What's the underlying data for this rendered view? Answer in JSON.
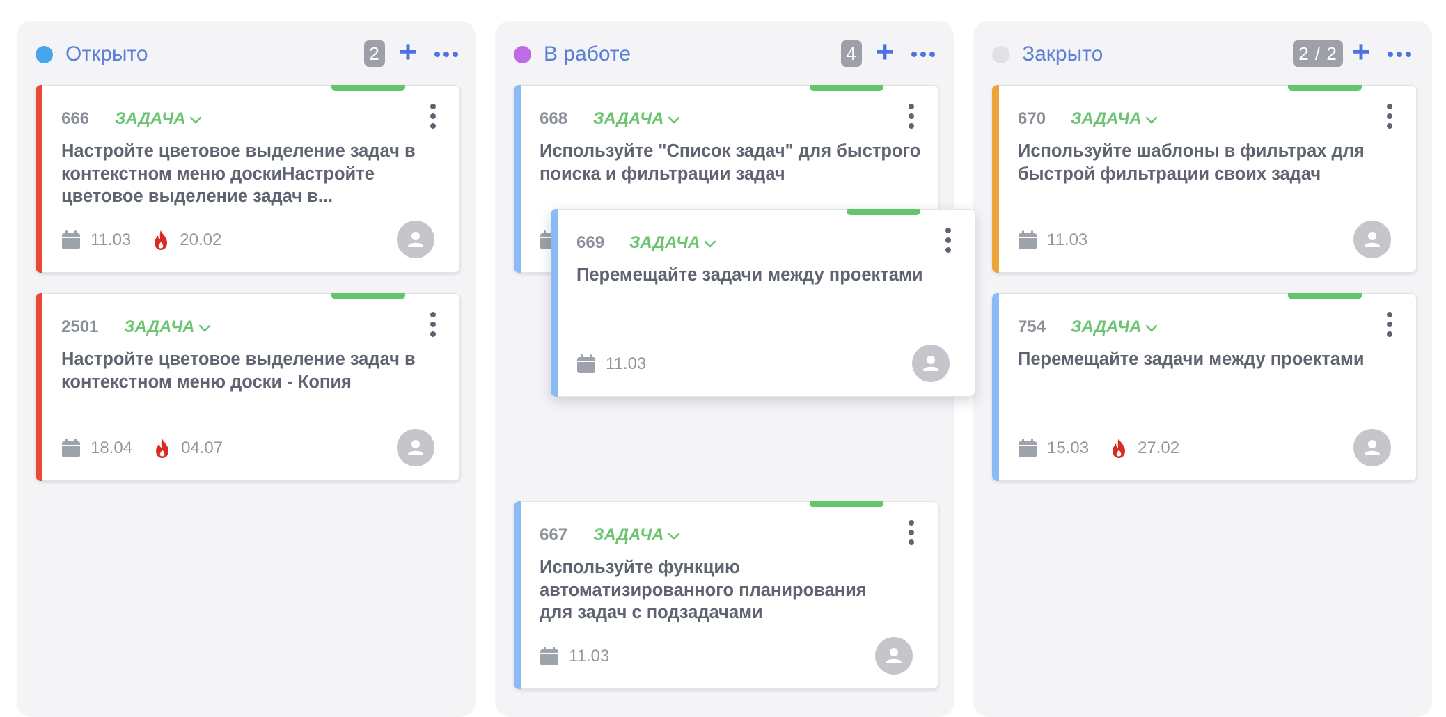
{
  "colors": {
    "open_dot": "#45a6ec",
    "progress_dot": "#c06be6",
    "closed_dot": "#dfe1e6",
    "red_bar": "#ea4a35",
    "blue_bar": "#8bbbf5",
    "orange_bar": "#eda43a",
    "type_green": "#6bc46f",
    "accent_blue": "#4f72e3"
  },
  "columns": [
    {
      "title": "Открыто",
      "count": "2",
      "add_icon": "plus-icon",
      "more_icon": "more-horizontal-icon"
    },
    {
      "title": "В работе",
      "count": "4",
      "add_icon": "plus-icon",
      "more_icon": "more-horizontal-icon"
    },
    {
      "title": "Закрыто",
      "count": "2 / 2",
      "add_icon": "plus-icon",
      "more_icon": "more-horizontal-icon"
    }
  ],
  "cards": [
    {
      "id": "666",
      "type": "ЗАДАЧА",
      "title": "Настройте цветовое выделение задач в контекстном меню доскиНастройте цветовое выделение задач в...",
      "date": "11.03",
      "deadline": "20.02"
    },
    {
      "id": "2501",
      "type": "ЗАДАЧА",
      "title": "Настройте цветовое выделение задач в контекстном меню доски - Копия",
      "date": "18.04",
      "deadline": "04.07"
    },
    {
      "id": "668",
      "type": "ЗАДАЧА",
      "title": "Используйте \"Список задач\" для быстрого поиска и фильтрации задач",
      "date": "",
      "deadline": ""
    },
    {
      "id": "669",
      "type": "ЗАДАЧА",
      "title": "Перемещайте задачи между проектами",
      "date": "11.03",
      "deadline": ""
    },
    {
      "id": "667",
      "type": "ЗАДАЧА",
      "title": "Используйте функцию автоматизированного планирования для задач с подзадачами",
      "date": "11.03",
      "deadline": ""
    },
    {
      "id": "670",
      "type": "ЗАДАЧА",
      "title": "Используйте шаблоны в фильтрах для быстрой фильтрации своих задач",
      "date": "11.03",
      "deadline": ""
    },
    {
      "id": "754",
      "type": "ЗАДАЧА",
      "title": "Перемещайте задачи между проектами",
      "date": "15.03",
      "deadline": "27.02"
    }
  ]
}
